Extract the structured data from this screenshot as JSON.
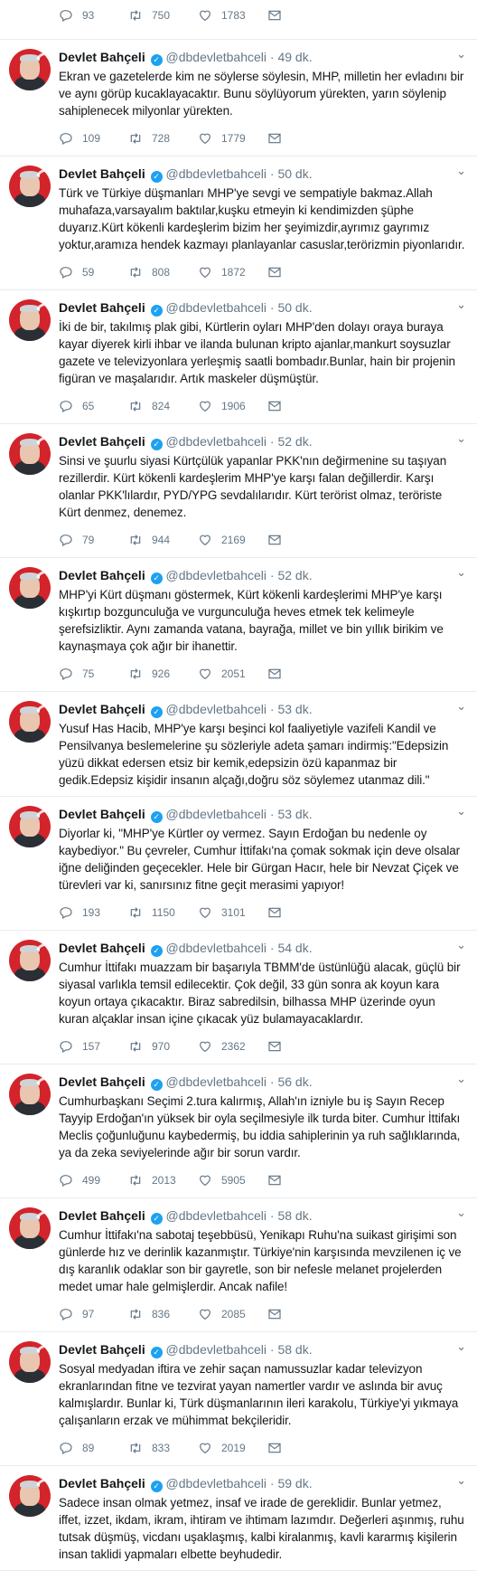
{
  "icons": [
    "reply-icon",
    "retweet-icon",
    "like-icon",
    "dm-icon",
    "verified-icon",
    "chevron-down-icon"
  ],
  "colors": {
    "accent": "#1da1f2",
    "muted": "#657786",
    "avatar_bg": "#d3232b"
  },
  "top_partial": {
    "replies": "93",
    "retweets": "750",
    "likes": "1783"
  },
  "tweets": [
    {
      "name": "Devlet Bahçeli",
      "handle": "@dbdevletbahceli",
      "dot": "·",
      "time": "49 dk.",
      "text": "Ekran ve gazetelerde kim ne söylerse söylesin, MHP, milletin her evladını bir ve aynı görüp kucaklayacaktır. Bunu söylüyorum yürekten, yarın söylenip sahiplenecek milyonlar yürekten.",
      "replies": "109",
      "retweets": "728",
      "likes": "1779"
    },
    {
      "name": "Devlet Bahçeli",
      "handle": "@dbdevletbahceli",
      "dot": "·",
      "time": "50 dk.",
      "text": "Türk ve Türkiye düşmanları MHP'ye sevgi ve sempatiyle bakmaz.Allah muhafaza,varsayalım baktılar,kuşku etmeyin ki kendimizden şüphe duyarız.Kürt kökenli kardeşlerim bizim her şeyimizdir,ayrımız gayrımız yoktur,aramıza hendek kazmayı planlayanlar casuslar,terörizmin piyonlarıdır.",
      "replies": "59",
      "retweets": "808",
      "likes": "1872"
    },
    {
      "name": "Devlet Bahçeli",
      "handle": "@dbdevletbahceli",
      "dot": "·",
      "time": "50 dk.",
      "text": "İki de bir, takılmış plak gibi, Kürtlerin oyları MHP'den dolayı oraya buraya kayar diyerek kirli ihbar ve ilanda bulunan kripto ajanlar,mankurt soysuzlar gazete ve televizyonlara yerleşmiş saatli bombadır.Bunlar, hain bir projenin figüran ve maşalarıdır. Artık maskeler düşmüştür.",
      "replies": "65",
      "retweets": "824",
      "likes": "1906"
    },
    {
      "name": "Devlet Bahçeli",
      "handle": "@dbdevletbahceli",
      "dot": "·",
      "time": "52 dk.",
      "text": "Sinsi ve şuurlu siyasi Kürtçülük yapanlar PKK'nın değirmenine su taşıyan rezillerdir. Kürt kökenli kardeşlerim MHP'ye karşı falan değillerdir. Karşı olanlar PKK'lılardır, PYD/YPG sevdalılarıdır. Kürt terörist olmaz, teröriste Kürt denmez, denemez.",
      "replies": "79",
      "retweets": "944",
      "likes": "2169"
    },
    {
      "name": "Devlet Bahçeli",
      "handle": "@dbdevletbahceli",
      "dot": "·",
      "time": "52 dk.",
      "text": "MHP'yi Kürt düşmanı göstermek, Kürt kökenli kardeşlerimi MHP'ye karşı kışkırtıp bozgunculuğa ve vurgunculuğa heves etmek tek kelimeyle şerefsizliktir. Aynı zamanda vatana, bayrağa, millet ve bin yıllık birikim ve kaynaşmaya çok ağır bir ihanettir.",
      "replies": "75",
      "retweets": "926",
      "likes": "2051"
    },
    {
      "name": "Devlet Bahçeli",
      "handle": "@dbdevletbahceli",
      "dot": "·",
      "time": "53 dk.",
      "text": "Yusuf Has Hacib, MHP'ye karşı beşinci kol faaliyetiyle vazifeli Kandil ve Pensilvanya beslemelerine şu sözleriyle adeta şamarı indirmiş:\"Edepsizin yüzü dikkat edersen etsiz bir kemik,edepsizin özü kapanmaz bir gedik.Edepsiz kişidir insanın alçağı,doğru söz söylemez utanmaz dili.\"",
      "replies": "",
      "retweets": "",
      "likes": "",
      "no_actions": true
    },
    {
      "name": "Devlet Bahçeli",
      "handle": "@dbdevletbahceli",
      "dot": "·",
      "time": "53 dk.",
      "text": "Diyorlar ki, \"MHP'ye Kürtler oy vermez. Sayın Erdoğan bu nedenle oy kaybediyor.\" Bu çevreler, Cumhur İttifakı'na çomak sokmak için deve olsalar iğne deliğinden geçecekler. Hele bir Gürgan Hacır, hele bir Nevzat Çiçek ve türevleri var ki, sanırsınız fitne geçit merasimi yapıyor!",
      "replies": "193",
      "retweets": "1150",
      "likes": "3101"
    },
    {
      "name": "Devlet Bahçeli",
      "handle": "@dbdevletbahceli",
      "dot": "·",
      "time": "54 dk.",
      "text": "Cumhur İttifakı muazzam bir başarıyla TBMM'de üstünlüğü alacak, güçlü bir siyasal varlıkla temsil edilecektir. Çok değil, 33 gün sonra ak koyun kara koyun ortaya çıkacaktır. Biraz sabredilsin, bilhassa MHP üzerinde oyun kuran alçaklar insan içine çıkacak yüz bulamayacaklardır.",
      "replies": "157",
      "retweets": "970",
      "likes": "2362"
    },
    {
      "name": "Devlet Bahçeli",
      "handle": "@dbdevletbahceli",
      "dot": "·",
      "time": "56 dk.",
      "text": "Cumhurbaşkanı Seçimi 2.tura kalırmış, Allah'ın izniyle bu iş Sayın Recep Tayyip Erdoğan'ın yüksek bir oyla seçilmesiyle ilk turda biter. Cumhur İttifakı Meclis çoğunluğunu kaybedermiş, bu iddia sahiplerinin ya ruh sağlıklarında, ya da zeka seviyelerinde ağır bir sorun vardır.",
      "replies": "499",
      "retweets": "2013",
      "likes": "5905"
    },
    {
      "name": "Devlet Bahçeli",
      "handle": "@dbdevletbahceli",
      "dot": "·",
      "time": "58 dk.",
      "text": "Cumhur İttifakı'na sabotaj teşebbüsü, Yenikapı Ruhu'na suikast girişimi son günlerde hız ve derinlik kazanmıştır. Türkiye'nin karşısında mevzilenen iç ve dış karanlık odaklar son bir gayretle, son bir nefesle melanet projelerden medet umar hale gelmişlerdir. Ancak nafile!",
      "replies": "97",
      "retweets": "836",
      "likes": "2085"
    },
    {
      "name": "Devlet Bahçeli",
      "handle": "@dbdevletbahceli",
      "dot": "·",
      "time": "58 dk.",
      "text": "Sosyal medyadan iftira ve zehir saçan namussuzlar kadar televizyon ekranlarından fitne ve tezvirat yayan namertler vardır ve aslında bir avuç kalmışlardır. Bunlar ki, Türk düşmanlarının ileri karakolu, Türkiye'yi yıkmaya çalışanların erzak ve mühimmat bekçileridir.",
      "replies": "89",
      "retweets": "833",
      "likes": "2019"
    },
    {
      "name": "Devlet Bahçeli",
      "handle": "@dbdevletbahceli",
      "dot": "·",
      "time": "59 dk.",
      "text": "Sadece insan olmak yetmez, insaf ve irade de gereklidir. Bunlar yetmez, iffet, izzet, ikdam, ikram, ihtiram ve ihtimam lazımdır. Değerleri aşınmış, ruhu tutsak düşmüş, vicdanı uşaklaşmış, kalbi kiralanmış, kavli kararmış kişilerin insan taklidi yapmaları elbette beyhudedir.",
      "replies": "",
      "retweets": "",
      "likes": "",
      "no_actions": true
    }
  ]
}
